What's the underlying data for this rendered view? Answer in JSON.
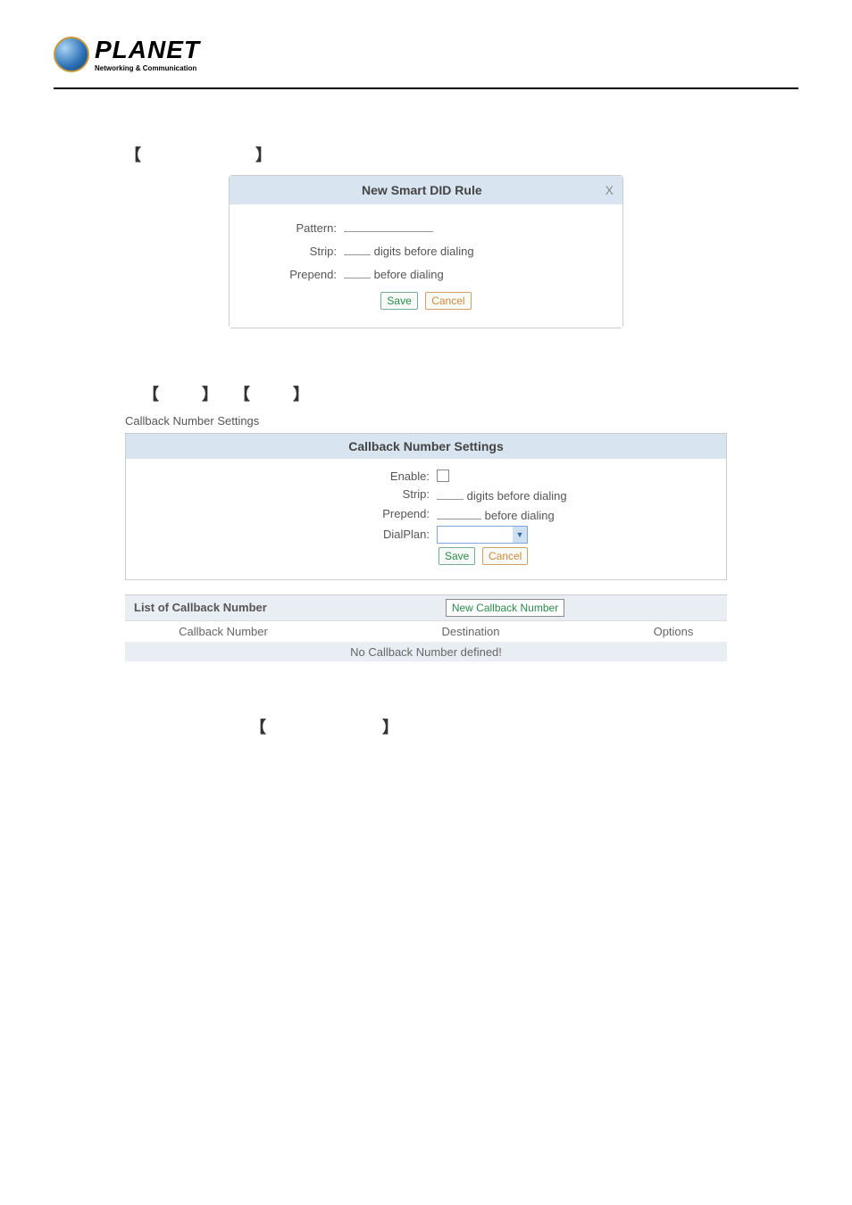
{
  "logo": {
    "brand": "PLANET",
    "tagline": "Networking & Communication"
  },
  "dialog1": {
    "title": "New Smart DID Rule",
    "close": "X",
    "pattern_label": "Pattern:",
    "strip_label": "Strip:",
    "strip_suffix": "digits before dialing",
    "prepend_label": "Prepend:",
    "prepend_suffix": "before dialing",
    "save": "Save",
    "cancel": "Cancel"
  },
  "callback": {
    "page_title": "Callback Number Settings",
    "panel_title": "Callback Number Settings",
    "enable_label": "Enable:",
    "strip_label": "Strip:",
    "strip_suffix": "digits before dialing",
    "prepend_label": "Prepend:",
    "prepend_suffix": "before dialing",
    "dialplan_label": "DialPlan:",
    "save": "Save",
    "cancel": "Cancel",
    "list_title": "List of Callback Number",
    "new_button": "New Callback Number",
    "col_number": "Callback Number",
    "col_destination": "Destination",
    "col_options": "Options",
    "empty": "No Callback Number defined!"
  }
}
